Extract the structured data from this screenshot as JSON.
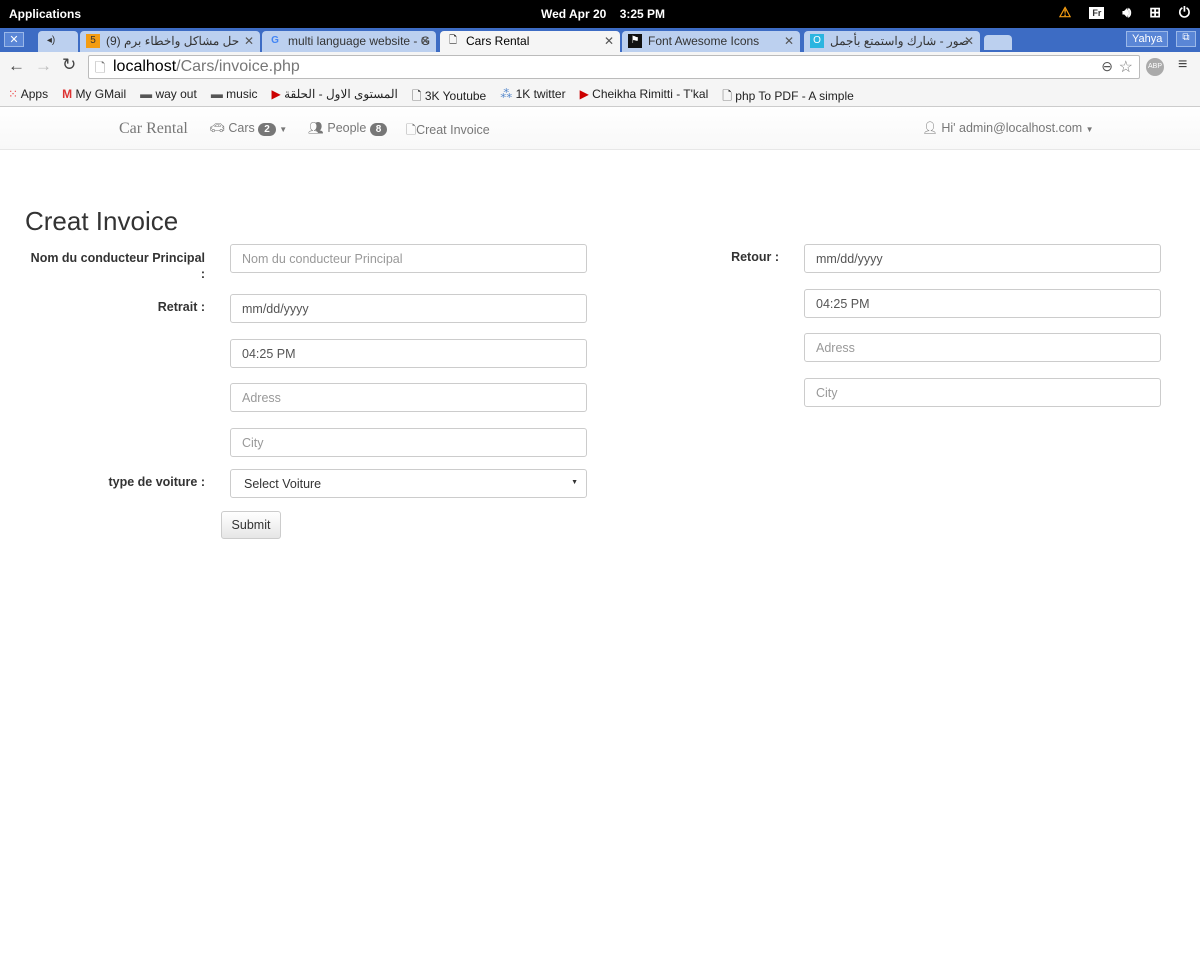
{
  "os": {
    "apps": "Applications",
    "clock_day": "Wed Apr 20",
    "clock_time": "3:25 PM",
    "lang": "Fr"
  },
  "browser": {
    "tabs": [
      {
        "label": "(9) حل مشاكل واخطاء برم"
      },
      {
        "label": "multi language website - G"
      },
      {
        "label": "Cars Rental"
      },
      {
        "label": "Font Awesome Icons"
      },
      {
        "label": "صور - شارك واستمتع بأجمل"
      }
    ],
    "profile": "Yahya",
    "url_host": "localhost",
    "url_path": "/Cars/invoice.php",
    "bookmarks": [
      "Apps",
      "My GMail",
      "way out",
      "music",
      "المستوى الاول - الحلقة",
      "3K Youtube",
      "1K twitter",
      "Cheikha Rimitti - T'kal",
      "php To PDF - A simple"
    ]
  },
  "nav": {
    "brand": "Car Rental",
    "cars": "Cars",
    "cars_count": "2",
    "people": "People",
    "people_count": "8",
    "invoice": "Creat Invoice",
    "user": "Hi' admin@localhost.com"
  },
  "form": {
    "title": "Creat Invoice",
    "driver_label": "Nom du conducteur Principal :",
    "driver_placeholder": "Nom du conducteur Principal",
    "pickup_label": "Retrait :",
    "return_label": "Retour :",
    "date": "mm/dd/yyyy",
    "time": "04:25 PM",
    "address_placeholder": "Adress",
    "city_placeholder": "City",
    "car_type_label": "type de voiture :",
    "car_select": "Select Voiture",
    "submit": "Submit"
  }
}
